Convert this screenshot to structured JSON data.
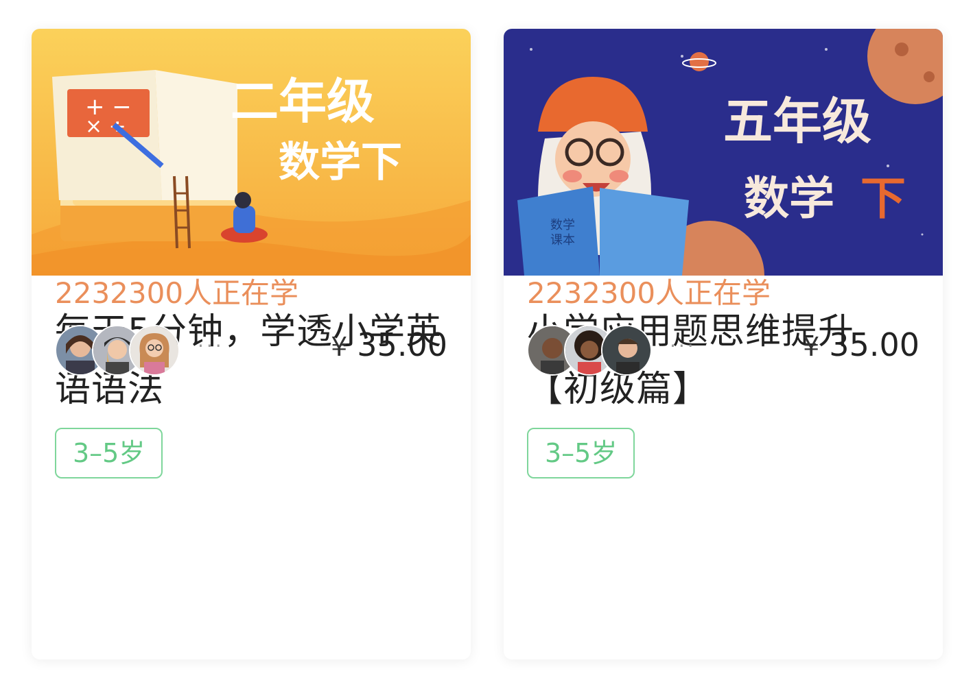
{
  "courses": [
    {
      "cover_title_line1": "二年级",
      "cover_title_line2": "数学下",
      "title": "每天5分钟，学透小学英语语法",
      "age_tag": "3–5岁",
      "learners": "2232300人正在学",
      "more": "···",
      "currency": "¥",
      "price": "35.00",
      "cover_bg": "#f9c447",
      "accent": "#ea8f5b"
    },
    {
      "cover_title_line1": "五年级",
      "cover_title_line2": "数学",
      "cover_title_extra": "下",
      "book_text_1": "数学",
      "book_text_2": "课本",
      "title": "小学应用题思维提升【初级篇】",
      "age_tag": "3–5岁",
      "learners": "2232300人正在学",
      "more": "···",
      "currency": "¥",
      "price": "35.00",
      "cover_bg": "#2b2f8f",
      "accent": "#ea8f5b"
    }
  ],
  "tag_color": "#63c985"
}
